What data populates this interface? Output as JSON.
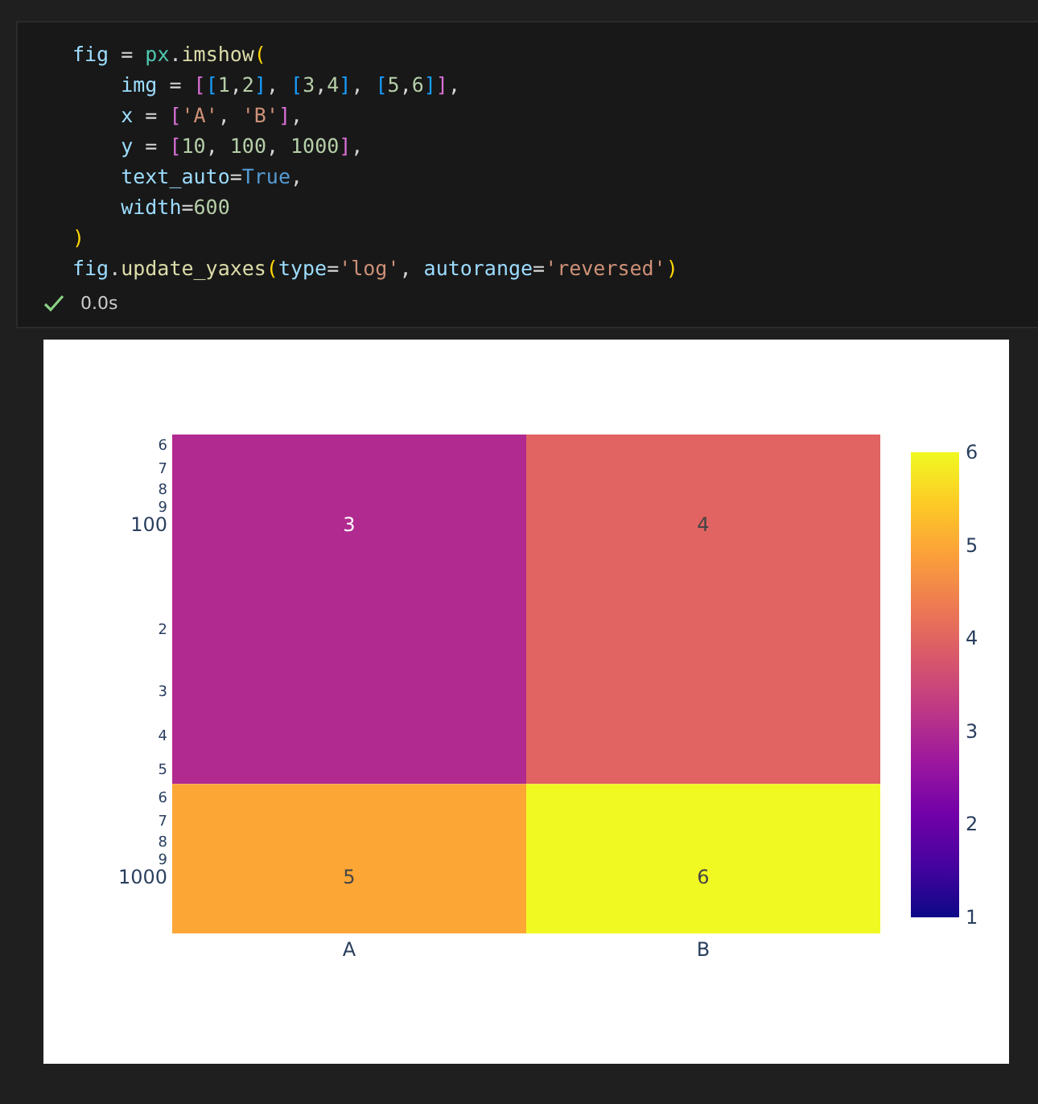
{
  "cell": {
    "code": [
      "fig = px.imshow(",
      "    img = [[1,2], [3,4], [5,6]],",
      "    x = ['A', 'B'],",
      "    y = [10, 100, 1000],",
      "    text_auto=True,",
      "    width=600",
      ")",
      "fig.update_yaxes(type='log', autorange='reversed')"
    ],
    "status": {
      "success": true,
      "time": "0.0s"
    }
  },
  "heatmap": {
    "rows": [
      [
        {
          "label": "3",
          "color": "#b12a90"
        },
        {
          "label": "4",
          "color": "#e16462"
        }
      ],
      [
        {
          "label": "5",
          "color": "#fca636"
        },
        {
          "label": "6",
          "color": "#f0f921"
        }
      ]
    ],
    "y_tick_labels": [
      "6",
      "7",
      "8",
      "9",
      "100",
      "2",
      "3",
      "4",
      "5",
      "6",
      "7",
      "8",
      "9",
      "1000"
    ],
    "x_tick_labels": [
      "A",
      "B"
    ],
    "colorbar_tick_labels": [
      "6",
      "5",
      "4",
      "3",
      "2",
      "1"
    ]
  }
}
